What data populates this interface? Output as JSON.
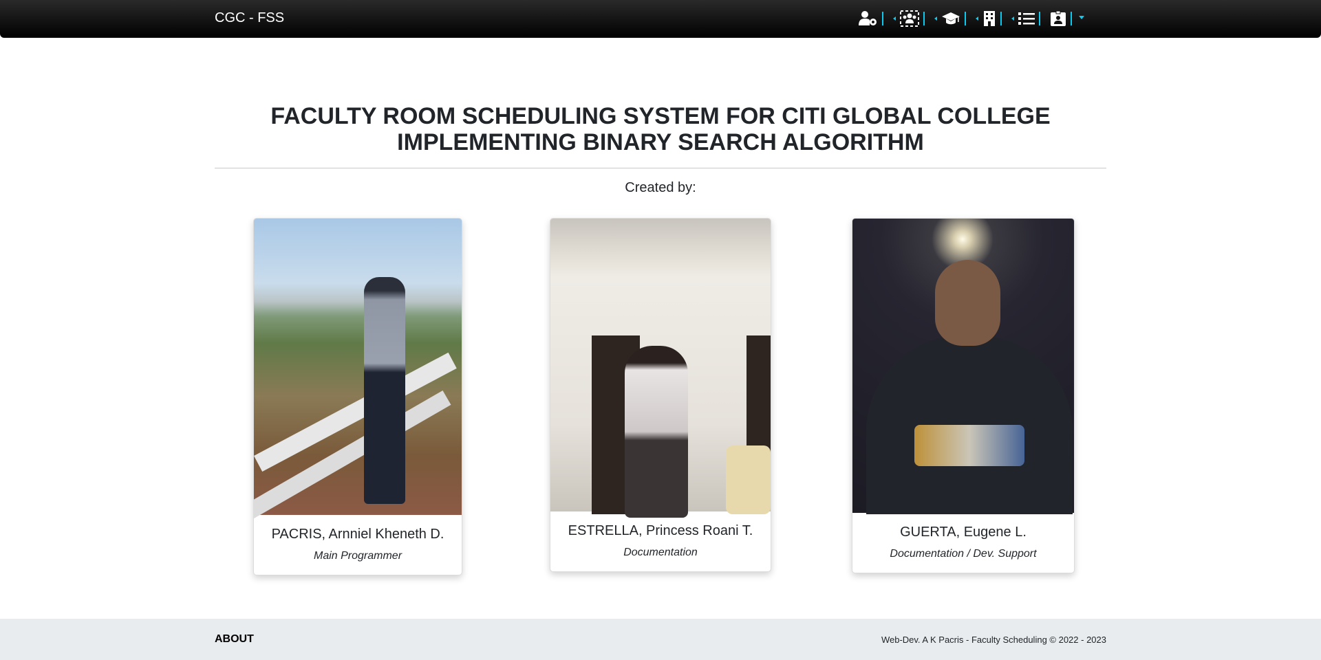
{
  "navbar": {
    "brand": "CGC - FSS",
    "icons": [
      "user-cog-icon",
      "users-icon",
      "graduation-cap-icon",
      "building-icon",
      "list-icon",
      "id-badge-icon"
    ]
  },
  "main": {
    "title_line1": "FACULTY ROOM SCHEDULING SYSTEM FOR CITI GLOBAL COLLEGE",
    "title_line2": "IMPLEMENTING BINARY SEARCH ALGORITHM",
    "created_by": "Created by:"
  },
  "team": [
    {
      "name": "PACRIS, Arnniel Kheneth D.",
      "role": "Main Programmer"
    },
    {
      "name": "ESTRELLA, Princess Roani T.",
      "role": "Documentation"
    },
    {
      "name": "GUERTA, Eugene L.",
      "role": "Documentation / Dev. Support"
    }
  ],
  "footer": {
    "about": "ABOUT",
    "copyright": "Web-Dev. A K Pacris - Faculty Scheduling © 2022 - 2023"
  },
  "colors": {
    "accent": "#0dcaf0",
    "navbar": "#000000",
    "footer": "#e9ecef"
  }
}
